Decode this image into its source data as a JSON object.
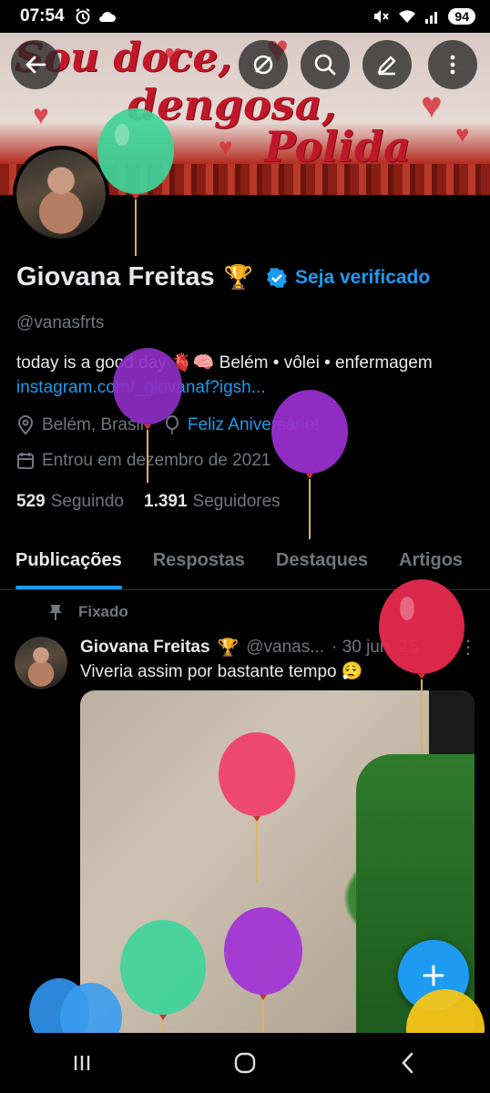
{
  "status_bar": {
    "time": "07:54",
    "battery": "94"
  },
  "banner": {
    "line1": "Sou doce,",
    "line2": "dengosa,",
    "line3": "Polida"
  },
  "profile": {
    "name": "Giovana Freitas",
    "badge_emoji": "🏆",
    "verify_label": "Seja verificado",
    "handle": "@vanasfrts",
    "bio": "today is a good day 🫀🧠 Belém • vôlei • enfermagem",
    "link": "instagram.com/_giovanaf?igsh...",
    "location": "Belém, Brasil",
    "birthday": "Feliz Aniversário!",
    "joined": "Entrou em dezembro de 2021",
    "following_count": "529",
    "following_label": "Seguindo",
    "followers_count": "1.391",
    "followers_label": "Seguidores"
  },
  "tabs": [
    {
      "label": "Publicações",
      "active": true
    },
    {
      "label": "Respostas",
      "active": false
    },
    {
      "label": "Destaques",
      "active": false
    },
    {
      "label": "Artigos",
      "active": false
    }
  ],
  "post": {
    "pinned_label": "Fixado",
    "author": "Giovana Freitas",
    "badge_emoji": "🏆",
    "handle": "@vanas...",
    "date": "· 30 jun. 25",
    "text": "Viveria assim por bastante tempo 😮‍💨"
  },
  "colors": {
    "accent": "#1d9bf0",
    "background": "#000000",
    "muted": "#71767b"
  },
  "icons": [
    "back-arrow-icon",
    "no-link-icon",
    "search-icon",
    "edit-icon",
    "more-vert-icon",
    "location-icon",
    "balloon-icon",
    "calendar-icon",
    "pin-icon",
    "plus-icon"
  ]
}
